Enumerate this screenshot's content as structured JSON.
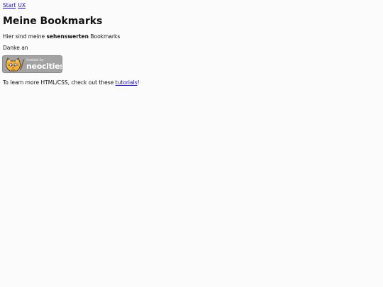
{
  "nav": {
    "links": [
      "Start",
      "UX"
    ]
  },
  "page_title": "Meine Bookmarks",
  "intro": {
    "before": "Hier sind meine ",
    "emphasis": "sehenswerten",
    "after": " Bookmarks"
  },
  "thanks": "Danke an",
  "badge": {
    "small_text": "hosted by",
    "brand": "neocities",
    "icon": "neocities-cat-icon",
    "bg_color": "#a3a3a3"
  },
  "learn": {
    "before": "To learn more HTML/CSS, check out these ",
    "link": "tutorials",
    "after": "!"
  },
  "colors": {
    "link": "#1a0dab",
    "background": "#fbfbfb"
  }
}
